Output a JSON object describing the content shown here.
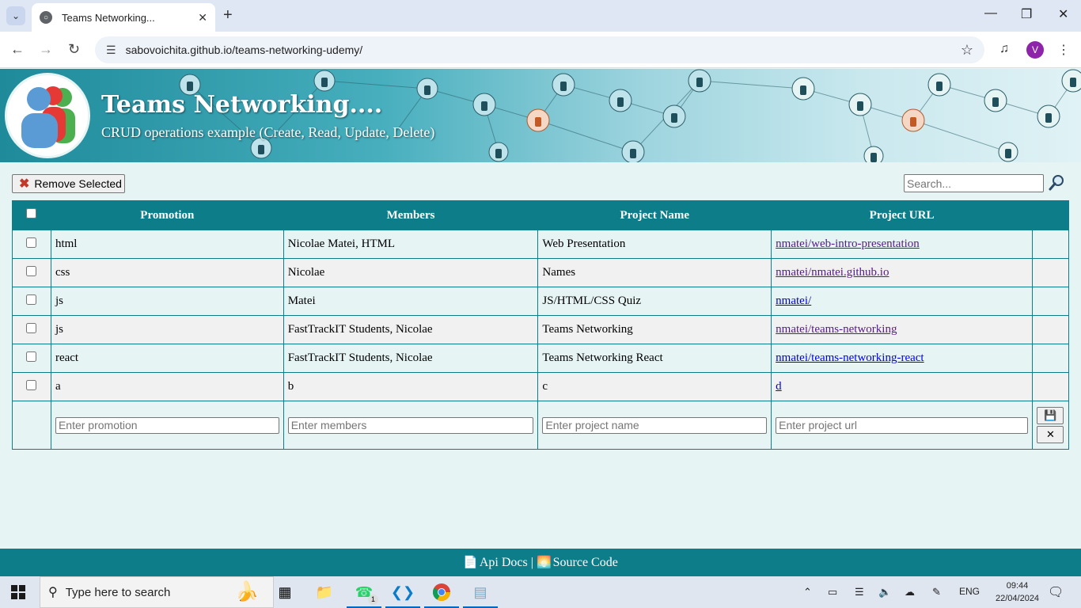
{
  "browser": {
    "tab_title": "Teams Networking...",
    "url": "sabovoichita.github.io/teams-networking-udemy/",
    "profile_initial": "V"
  },
  "header": {
    "title": "Teams Networking....",
    "subtitle": "CRUD operations example (Create, Read, Update, Delete)"
  },
  "toolbar": {
    "remove_label": "Remove Selected",
    "search_placeholder": "Search..."
  },
  "table": {
    "columns": [
      "Promotion",
      "Members",
      "Project Name",
      "Project URL"
    ],
    "rows": [
      {
        "promotion": "html",
        "members": "Nicolae Matei, HTML",
        "name": "Web Presentation",
        "url": "nmatei/web-intro-presentation"
      },
      {
        "promotion": "css",
        "members": "Nicolae",
        "name": "Names",
        "url": "nmatei/nmatei.github.io"
      },
      {
        "promotion": "js",
        "members": "Matei",
        "name": "JS/HTML/CSS Quiz",
        "url": "nmatei/"
      },
      {
        "promotion": "js",
        "members": "FastTrackIT Students, Nicolae",
        "name": "Teams Networking",
        "url": "nmatei/teams-networking"
      },
      {
        "promotion": "react",
        "members": "FastTrackIT Students, Nicolae",
        "name": "Teams Networking React",
        "url": "nmatei/teams-networking-react"
      },
      {
        "promotion": "a",
        "members": "b",
        "name": "c",
        "url": "d"
      }
    ],
    "form": {
      "promotion_placeholder": "Enter promotion",
      "members_placeholder": "Enter members",
      "name_placeholder": "Enter project name",
      "url_placeholder": "Enter project url"
    }
  },
  "footer": {
    "api_docs": "Api Docs",
    "separator": "|",
    "source_code": "Source Code"
  },
  "taskbar": {
    "search_placeholder": "Type here to search",
    "language": "ENG",
    "time": "09:44",
    "date": "22/04/2024",
    "whatsapp_badge": "1"
  }
}
